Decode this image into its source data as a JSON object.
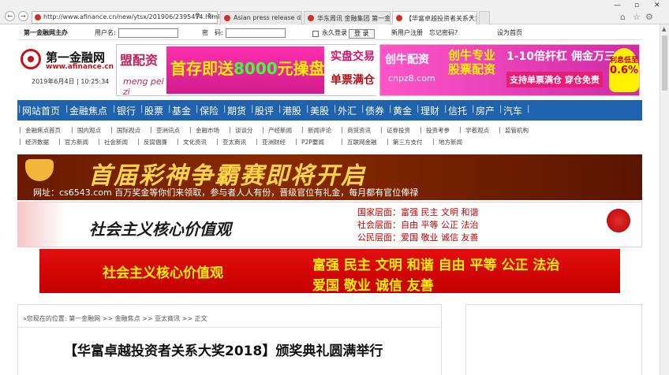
{
  "browser": {
    "url": "http://www.afinance.cn/new/ytsx/201906/2395474.html",
    "tabs": [
      {
        "label": "Asian press release distribu...",
        "active": false
      },
      {
        "label": "华东周讯 金融集团 第一金...",
        "active": false
      },
      {
        "label": "【华富卓越投资者关系大奖...",
        "active": true
      }
    ]
  },
  "login": {
    "slogan": "第一金融网主办",
    "username_label": "用户名:",
    "password_label": "密　码:",
    "remember_label": "永久登录",
    "login_button": "登 录",
    "register_link": "新用户注册",
    "forgot_link": "忘记密码?",
    "homepage_link": "设为首页"
  },
  "logo": {
    "name_cn": "第一金融网",
    "domain": "www.afinance.cn",
    "date": "2019年6月4日 | 10:25:34"
  },
  "ad1": {
    "brand": "盟配资",
    "pinyin": "meng pei zi",
    "main_prefix": "首存即送",
    "main_num": "8000",
    "main_suffix": "元操盘资金",
    "right1": "实盘交易",
    "right2": "单票满仓"
  },
  "ad2": {
    "logo": "创牛配资",
    "url": "cnpz8.com",
    "cn1": "创牛专业股票配资",
    "r1": "1-10倍杆杠 佣金万三",
    "r2": "支持单票满仓 穿仓免责",
    "badge1": "利息低至",
    "badge2": "0.6%"
  },
  "mainnav": [
    "网站首页",
    "金融焦点",
    "银行",
    "股票",
    "基金",
    "保险",
    "期货",
    "股评",
    "港股",
    "美股",
    "外汇",
    "债券",
    "黄金",
    "理财",
    "信托",
    "房产",
    "汽车"
  ],
  "subnav": {
    "row1": [
      "金融焦点首页",
      "国内观点",
      "国际视点",
      "亚洲讯点",
      "金融市场",
      "谈谈分",
      "产经新闻",
      "新闻评论",
      "商贸资讯",
      "证券投资",
      "投资考参",
      "学者观点",
      "监管机构"
    ],
    "row2": [
      "经济数据",
      "官方新闻",
      "社会新闻",
      "反腐倡廉",
      "文化资讯",
      "亚太商讯",
      "亚洲财经",
      "P2P要闻",
      "互联网金融",
      "第三方支付",
      "地方新闻"
    ]
  },
  "banner1": {
    "title": "首届彩神争霸赛即将开启",
    "sub": "网址：cs6543.com 百万奖金等你们来领取，参与者人人有份，晋级官位有礼金，每月都有官位俸禄"
  },
  "banner2": {
    "slogan": "社会主义核心价值观",
    "vals": [
      "国家层面：富强 民主 文明 和谐",
      "社会层面：自由 平等 公正 法治",
      "公民层面：爱国 敬业 诚信 友善"
    ]
  },
  "banner3": {
    "left": "社会主义核心价值观",
    "line1": "富强 民主 文明 和谐 自由 平等 公正 法治",
    "line2": "爱国 敬业 诚信 友善"
  },
  "article": {
    "breadcrumb": "»您现在的位置:  第一金融网 >> 金融焦点 >> 亚太商讯 >> 正文",
    "title": "【华富卓越投资者关系大奖2018】颁奖典礼圆满举行"
  }
}
